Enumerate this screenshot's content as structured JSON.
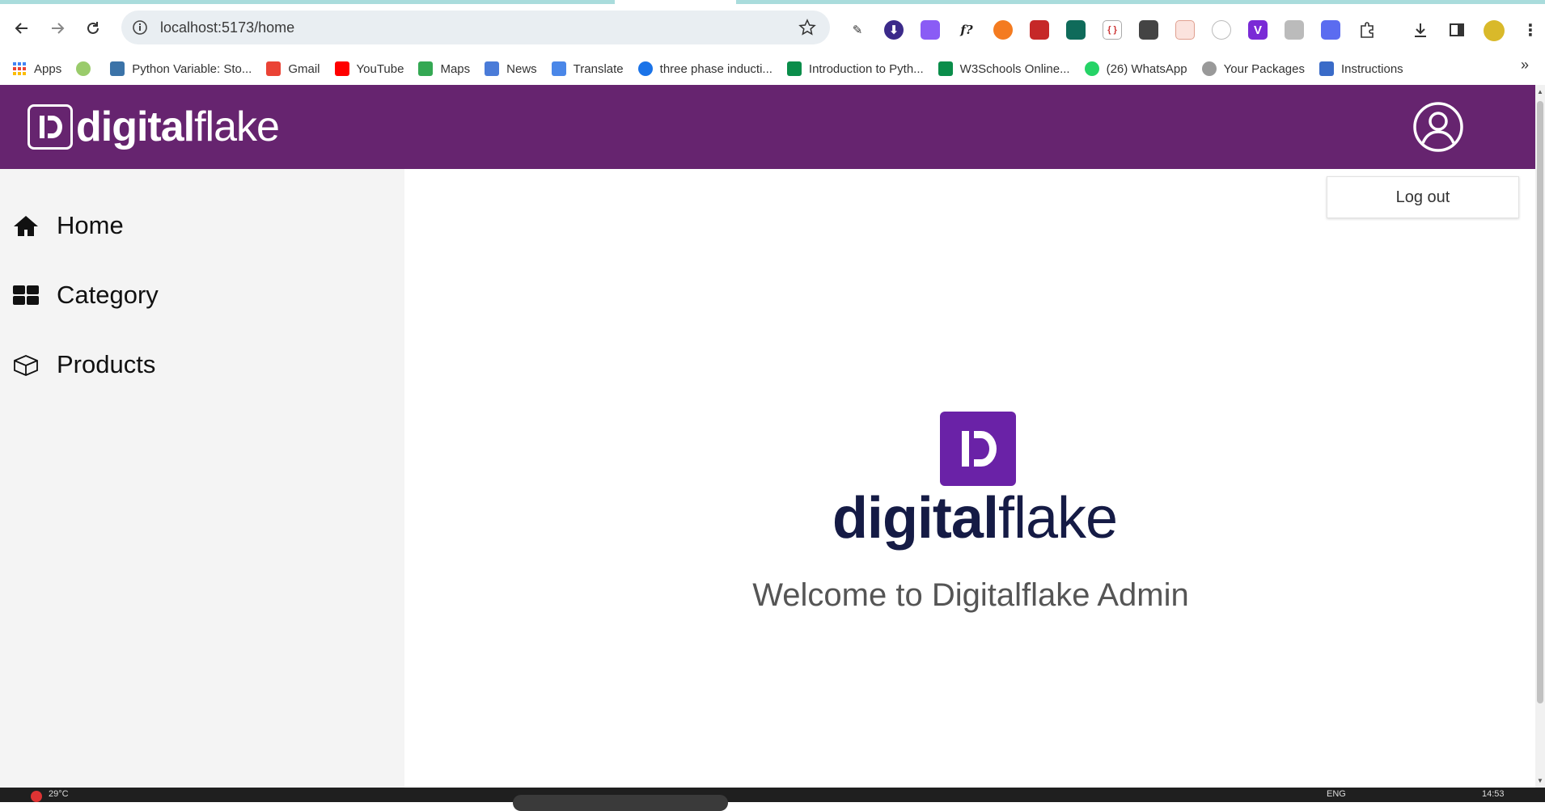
{
  "browser": {
    "url": "localhost:5173/home",
    "bookmarks": [
      {
        "label": "Apps",
        "color": "#4285f4"
      },
      {
        "label": "",
        "color": "#9acb6b"
      },
      {
        "label": "Python Variable: Sto...",
        "color": "#3b73a8"
      },
      {
        "label": "Gmail",
        "color": "#ea4335"
      },
      {
        "label": "YouTube",
        "color": "#ff0000"
      },
      {
        "label": "Maps",
        "color": "#34a853"
      },
      {
        "label": "News",
        "color": "#4a7bd8"
      },
      {
        "label": "Translate",
        "color": "#4a87e8"
      },
      {
        "label": "three phase inducti...",
        "color": "#1a73e8"
      },
      {
        "label": "Introduction to Pyth...",
        "color": "#0a8d4a"
      },
      {
        "label": "W3Schools Online...",
        "color": "#0a8d4a"
      },
      {
        "label": "(26) WhatsApp",
        "color": "#25d366"
      },
      {
        "label": "Your Packages",
        "color": "#999999"
      },
      {
        "label": "Instructions",
        "color": "#3a6bc8"
      }
    ],
    "bookmarks_more": "»"
  },
  "header": {
    "brand_bold": "digital",
    "brand_light": "flake",
    "bg_color": "#66246f"
  },
  "sidebar": {
    "items": [
      {
        "label": "Home",
        "icon": "home-icon"
      },
      {
        "label": "Category",
        "icon": "grid-icon"
      },
      {
        "label": "Products",
        "icon": "box-icon"
      }
    ]
  },
  "menu": {
    "logout_label": "Log out"
  },
  "main": {
    "brand_bold": "digital",
    "brand_light": "flake",
    "welcome": "Welcome to Digitalflake Admin",
    "logo_color": "#6a22a7"
  },
  "taskbar": {
    "weather": "29°C",
    "lang": "ENG",
    "time": "14:53"
  }
}
